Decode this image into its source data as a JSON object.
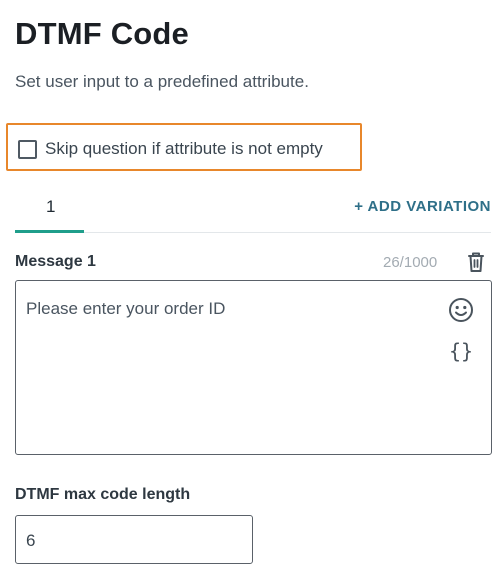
{
  "page": {
    "title": "DTMF Code",
    "subtitle": "Set user input to a predefined attribute."
  },
  "skip_option": {
    "label": "Skip question if attribute is not empty",
    "checked": false,
    "highlight_color": "#e8872b"
  },
  "tabs": {
    "items": [
      {
        "label": "1",
        "active": true
      }
    ],
    "add_variation_label": "+ ADD VARIATION",
    "active_color": "#1f9e8b"
  },
  "message": {
    "label": "Message 1",
    "char_count": "26/1000",
    "text": "Please enter your order ID",
    "icons": [
      "trash-icon",
      "emoji-icon",
      "variable-braces-icon"
    ],
    "braces_glyph": "{}"
  },
  "dtmf_length": {
    "label": "DTMF max code length",
    "value": "6"
  }
}
